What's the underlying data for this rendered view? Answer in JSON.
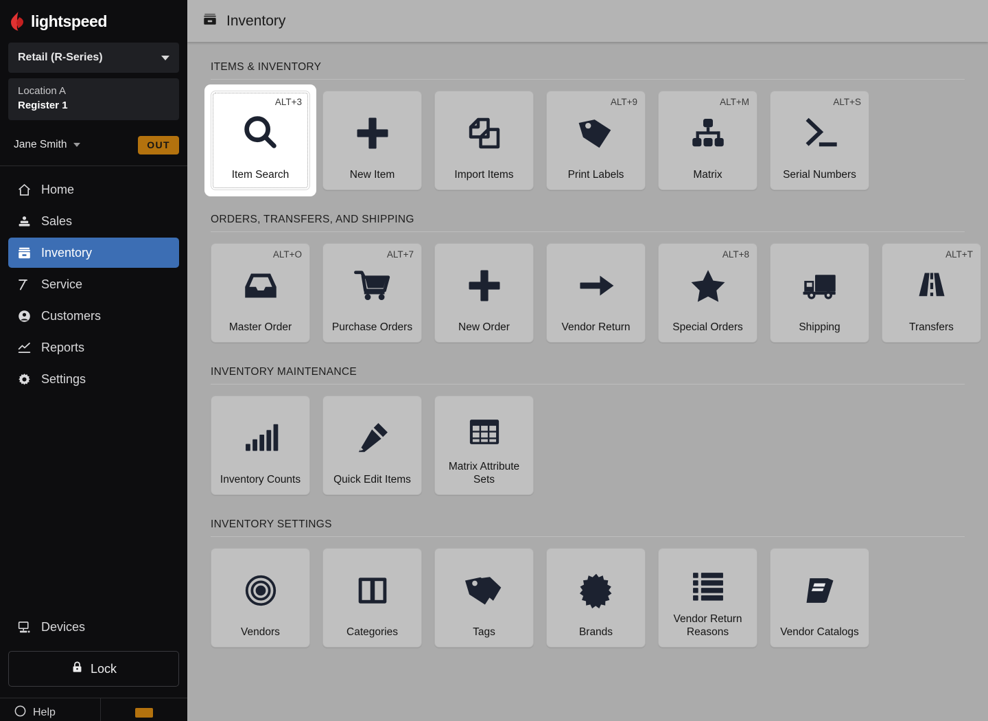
{
  "sidebar": {
    "brand": "lightspeed",
    "business_selector": {
      "label": "Retail (R-Series)",
      "caret_icon": "chevron-down-icon"
    },
    "location": {
      "name": "Location A",
      "register": "Register 1"
    },
    "user": {
      "name": "Jane Smith",
      "caret_icon": "chevron-down-icon",
      "status_badge": "OUT"
    },
    "nav_items": [
      {
        "label": "Home",
        "icon": "home-icon",
        "active": false
      },
      {
        "label": "Sales",
        "icon": "sales-icon",
        "active": false
      },
      {
        "label": "Inventory",
        "icon": "inventory-box-icon",
        "active": true
      },
      {
        "label": "Service",
        "icon": "hammer-icon",
        "active": false
      },
      {
        "label": "Customers",
        "icon": "user-circle-icon",
        "active": false
      },
      {
        "label": "Reports",
        "icon": "chart-line-icon",
        "active": false
      },
      {
        "label": "Settings",
        "icon": "gear-icon",
        "active": false
      }
    ],
    "devices": {
      "label": "Devices",
      "icon": "monitor-icon"
    },
    "lock": {
      "label": "Lock",
      "icon": "lock-icon"
    },
    "footer": {
      "help_label": "Help",
      "help_icon": "help-circle-icon"
    }
  },
  "header": {
    "title": "Inventory",
    "icon": "inventory-box-icon"
  },
  "sections": [
    {
      "id": "items-inventory",
      "heading": "ITEMS & INVENTORY",
      "tiles": [
        {
          "label": "Item Search",
          "shortcut": "ALT+3",
          "icon": "magnifier-icon",
          "focused": true
        },
        {
          "label": "New Item",
          "shortcut": "",
          "icon": "plus-icon",
          "focused": false
        },
        {
          "label": "Import Items",
          "shortcut": "",
          "icon": "documents-icon",
          "focused": false
        },
        {
          "label": "Print Labels",
          "shortcut": "ALT+9",
          "icon": "tag-icon",
          "focused": false
        },
        {
          "label": "Matrix",
          "shortcut": "ALT+M",
          "icon": "hierarchy-icon",
          "focused": false
        },
        {
          "label": "Serial Numbers",
          "shortcut": "ALT+S",
          "icon": "terminal-icon",
          "focused": false
        }
      ]
    },
    {
      "id": "orders-transfers-shipping",
      "heading": "ORDERS, TRANSFERS, AND SHIPPING",
      "tiles": [
        {
          "label": "Master Order",
          "shortcut": "ALT+O",
          "icon": "inbox-icon",
          "focused": false
        },
        {
          "label": "Purchase Orders",
          "shortcut": "ALT+7",
          "icon": "shopping-cart-icon",
          "focused": false
        },
        {
          "label": "New Order",
          "shortcut": "",
          "icon": "plus-icon",
          "focused": false
        },
        {
          "label": "Vendor Return",
          "shortcut": "",
          "icon": "arrow-right-icon",
          "focused": false
        },
        {
          "label": "Special Orders",
          "shortcut": "ALT+8",
          "icon": "star-icon",
          "focused": false
        },
        {
          "label": "Shipping",
          "shortcut": "",
          "icon": "truck-icon",
          "focused": false
        },
        {
          "label": "Transfers",
          "shortcut": "ALT+T",
          "icon": "road-icon",
          "focused": false
        }
      ]
    },
    {
      "id": "inventory-maintenance",
      "heading": "INVENTORY MAINTENANCE",
      "tiles": [
        {
          "label": "Inventory Counts",
          "shortcut": "",
          "icon": "bar-chart-icon",
          "focused": false
        },
        {
          "label": "Quick Edit Items",
          "shortcut": "",
          "icon": "pencil-icon",
          "focused": false
        },
        {
          "label": "Matrix Attribute Sets",
          "shortcut": "",
          "icon": "grid-table-icon",
          "focused": false
        }
      ]
    },
    {
      "id": "inventory-settings",
      "heading": "INVENTORY SETTINGS",
      "tiles": [
        {
          "label": "Vendors",
          "shortcut": "",
          "icon": "target-icon",
          "focused": false
        },
        {
          "label": "Categories",
          "shortcut": "",
          "icon": "columns-icon",
          "focused": false
        },
        {
          "label": "Tags",
          "shortcut": "",
          "icon": "tags-icon",
          "focused": false
        },
        {
          "label": "Brands",
          "shortcut": "",
          "icon": "burst-badge-icon",
          "focused": false
        },
        {
          "label": "Vendor Return Reasons",
          "shortcut": "",
          "icon": "list-icon",
          "focused": false
        },
        {
          "label": "Vendor Catalogs",
          "shortcut": "",
          "icon": "book-icon",
          "focused": false
        }
      ]
    }
  ],
  "colors": {
    "sidebar_bg": "#0d0d0f",
    "active_nav": "#3c6eb4",
    "brand_red": "#e03232",
    "badge_amber": "#b3720e",
    "content_bg": "#ababab",
    "tile_bg": "#c0c0c0",
    "icon_dark": "#1c2230"
  }
}
